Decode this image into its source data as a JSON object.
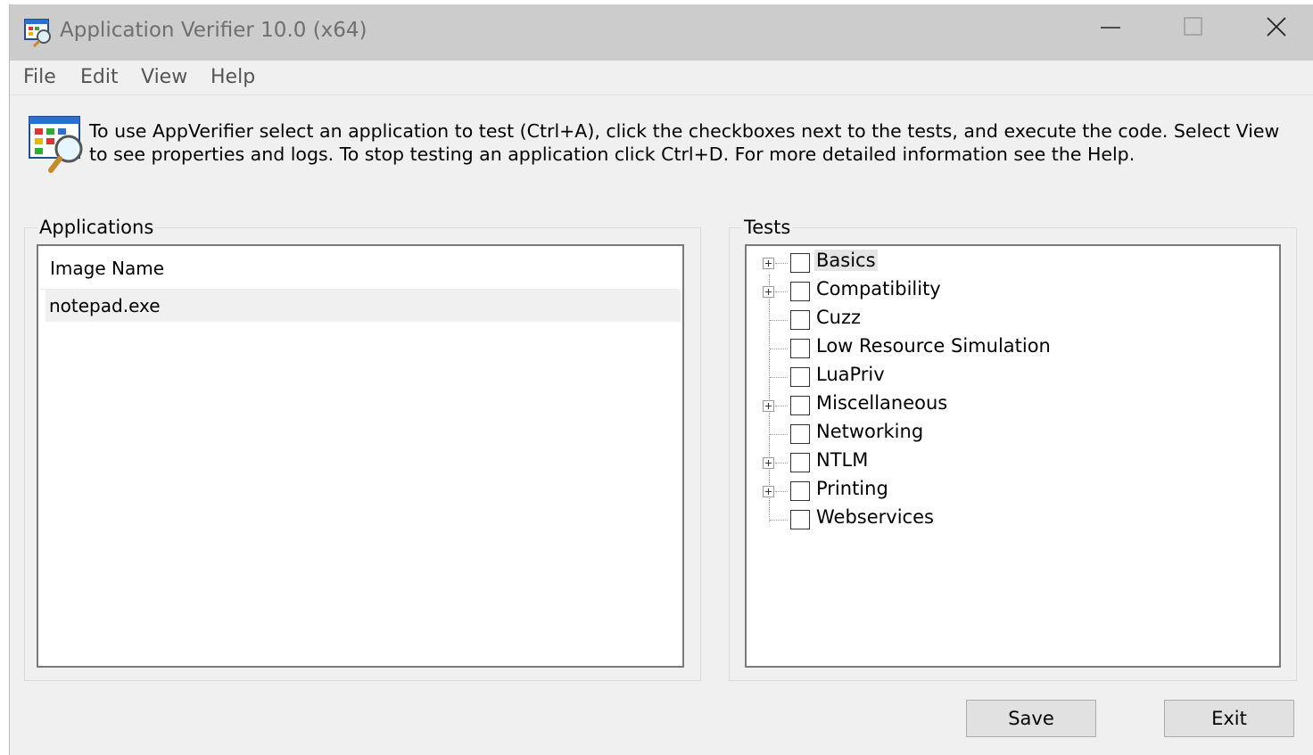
{
  "window": {
    "title": "Application Verifier 10.0 (x64)"
  },
  "menu": [
    "File",
    "Edit",
    "View",
    "Help"
  ],
  "info": {
    "text": "To use AppVerifier select an application to test (Ctrl+A), click the checkboxes next to the tests, and execute the code. Select View to see properties and logs. To stop testing an application click Ctrl+D. For more detailed information see the Help."
  },
  "applications": {
    "group_label": "Applications",
    "column_header": "Image Name",
    "rows": [
      "notepad.exe"
    ]
  },
  "tests": {
    "group_label": "Tests",
    "items": [
      {
        "label": "Basics",
        "expandable": true,
        "checked": false
      },
      {
        "label": "Compatibility",
        "expandable": true,
        "checked": false
      },
      {
        "label": "Cuzz",
        "expandable": false,
        "checked": false
      },
      {
        "label": "Low Resource Simulation",
        "expandable": false,
        "checked": false
      },
      {
        "label": "LuaPriv",
        "expandable": false,
        "checked": false
      },
      {
        "label": "Miscellaneous",
        "expandable": true,
        "checked": false
      },
      {
        "label": "Networking",
        "expandable": false,
        "checked": false
      },
      {
        "label": "NTLM",
        "expandable": true,
        "checked": false
      },
      {
        "label": "Printing",
        "expandable": true,
        "checked": false
      },
      {
        "label": "Webservices",
        "expandable": false,
        "checked": false
      }
    ]
  },
  "buttons": {
    "save": "Save",
    "exit": "Exit"
  },
  "icons": {
    "app": "app-verifier-icon",
    "info": "magnifier-app-icon",
    "minimize": "minimize-icon",
    "maximize": "maximize-icon",
    "close": "close-icon",
    "expand": "plus-expander-icon"
  }
}
